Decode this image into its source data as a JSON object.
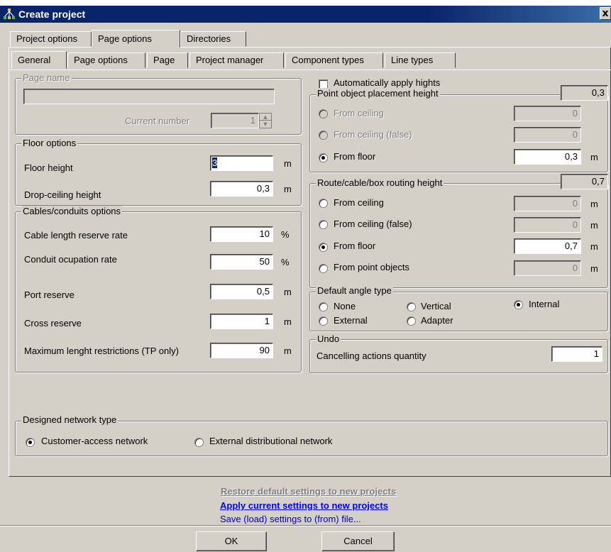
{
  "window": {
    "title": "Create project",
    "close_glyph": "x"
  },
  "tabs_top": [
    "Project options",
    "Page options",
    "Directories"
  ],
  "tabs_sub": [
    "General",
    "Page options",
    "Page",
    "Project manager",
    "Component types",
    "Line types"
  ],
  "page_name": {
    "group_label": "Page name",
    "value": "",
    "current_number_label": "Current number",
    "current_number_value": "1"
  },
  "floor": {
    "group_label": "Floor options",
    "floor_height_label": "Floor height",
    "floor_height_value": "3",
    "drop_ceiling_label": "Drop-ceiling height",
    "drop_ceiling_value": "0,3",
    "unit": "m"
  },
  "cables": {
    "group_label": "Cables/conduits options",
    "rows": [
      {
        "label": "Cable length reserve rate",
        "value": "10",
        "unit": "%"
      },
      {
        "label": "Conduit ocupation rate",
        "value": "50",
        "unit": "%"
      },
      {
        "label": "Port reserve",
        "value": "0,5",
        "unit": "m"
      },
      {
        "label": "Cross reserve",
        "value": "1",
        "unit": "m"
      },
      {
        "label": "Maximum lenght restrictions (TP only)",
        "value": "90",
        "unit": "m"
      }
    ]
  },
  "auto_apply": {
    "label": "Automatically apply hights",
    "checked": false
  },
  "point_height": {
    "group_label": "Point object placement height",
    "summary": "0,3",
    "options": [
      {
        "label": "From ceiling",
        "value": "0",
        "enabled": false,
        "selected": false
      },
      {
        "label": "From ceiling (false)",
        "value": "0",
        "enabled": false,
        "selected": false
      },
      {
        "label": "From floor",
        "value": "0,3",
        "enabled": true,
        "selected": true,
        "unit": "m"
      }
    ]
  },
  "route_height": {
    "group_label": "Route/cable/box routing height",
    "summary": "0,7",
    "options": [
      {
        "label": "From ceiling",
        "value": "0",
        "unit": "m"
      },
      {
        "label": "From ceiling (false)",
        "value": "0",
        "unit": "m"
      },
      {
        "label": "From floor",
        "value": "0,7",
        "unit": "m"
      },
      {
        "label": "From point objects",
        "value": "0",
        "unit": "m"
      }
    ]
  },
  "angle": {
    "group_label": "Default angle type",
    "options": [
      "None",
      "Vertical",
      "Internal",
      "External",
      "Adapter"
    ],
    "selected": "Internal"
  },
  "undo": {
    "group_label": "Undo",
    "label": "Cancelling actions quantity",
    "value": "1"
  },
  "network": {
    "group_label": "Designed network type",
    "options": [
      "Customer-access network",
      "External distributional network"
    ],
    "selected": "Customer-access network"
  },
  "links": {
    "restore": "Restore default settings to new projects",
    "apply": "Apply current settings to new projects",
    "save_load": "Save (load) settings to (from) file..."
  },
  "buttons": {
    "ok": "OK",
    "cancel": "Cancel"
  }
}
